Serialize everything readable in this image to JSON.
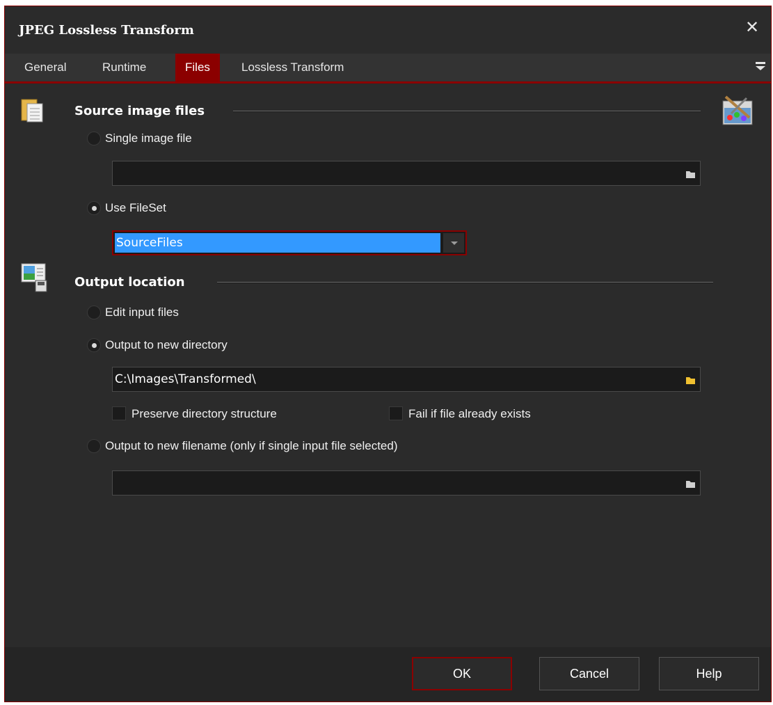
{
  "window": {
    "title": "JPEG Lossless Transform"
  },
  "tabs": [
    {
      "label": "General"
    },
    {
      "label": "Runtime"
    },
    {
      "label": "Files"
    },
    {
      "label": "Lossless Transform"
    }
  ],
  "active_tab": "Files",
  "source": {
    "title": "Source image files",
    "single_label": "Single image file",
    "single_value": "",
    "fileset_label": "Use FileSet",
    "fileset_value": "SourceFiles",
    "selected": "Use FileSet"
  },
  "output": {
    "title": "Output location",
    "edit_label": "Edit input files",
    "new_dir_label": "Output to new directory",
    "new_dir_value": "C:\\Images\\Transformed\\",
    "preserve_label": "Preserve directory structure",
    "preserve_checked": false,
    "fail_label": "Fail if file already exists",
    "fail_checked": false,
    "new_filename_label": "Output to new filename (only if single input file selected)",
    "new_filename_value": "",
    "selected": "Output to new directory"
  },
  "buttons": {
    "ok": "OK",
    "cancel": "Cancel",
    "help": "Help"
  },
  "colors": {
    "accent": "#8b0000",
    "background": "#2b2b2b",
    "selection": "#3399ff"
  }
}
